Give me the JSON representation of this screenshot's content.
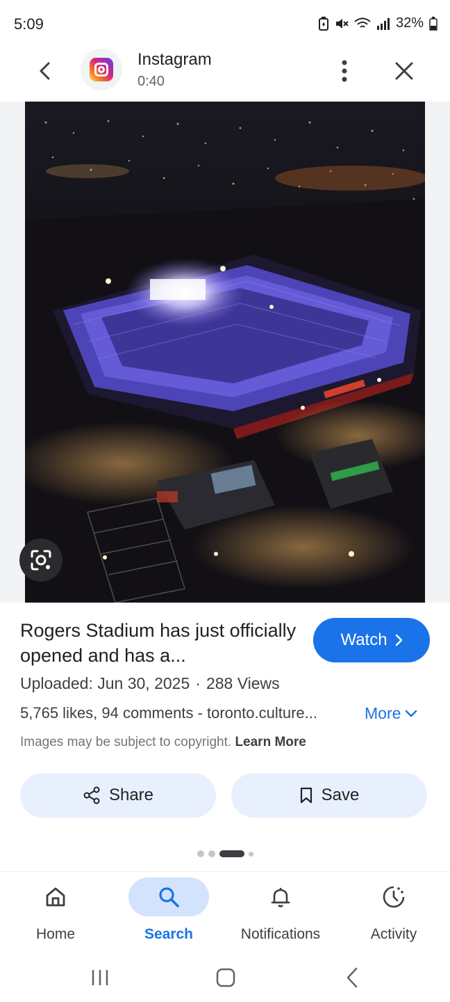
{
  "status": {
    "time": "5:09",
    "battery": "32%"
  },
  "header": {
    "app_name": "Instagram",
    "duration": "0:40",
    "app_icon": "instagram-icon"
  },
  "result": {
    "title": "Rogers Stadium has just officially opened and has a...",
    "watch_label": "Watch",
    "uploaded": "Uploaded: Jun 30, 2025",
    "separator": "·",
    "views": "288 Views",
    "stats": "5,765 likes, 94 comments - toronto.culture...",
    "more_label": "More",
    "copyright_text": "Images may be subject to copyright.",
    "learn_more_label": "Learn More"
  },
  "actions": {
    "share_label": "Share",
    "save_label": "Save"
  },
  "pager": {
    "count": 4,
    "active_index": 2
  },
  "nav": {
    "items": [
      {
        "label": "Home",
        "icon": "home-icon"
      },
      {
        "label": "Search",
        "icon": "search-icon"
      },
      {
        "label": "Notifications",
        "icon": "bell-icon"
      },
      {
        "label": "Activity",
        "icon": "activity-icon"
      }
    ],
    "active": "Search"
  },
  "colors": {
    "accent": "#1a73e8",
    "chip_bg": "#e8f0fe",
    "nav_active_bg": "#d3e3fd"
  }
}
